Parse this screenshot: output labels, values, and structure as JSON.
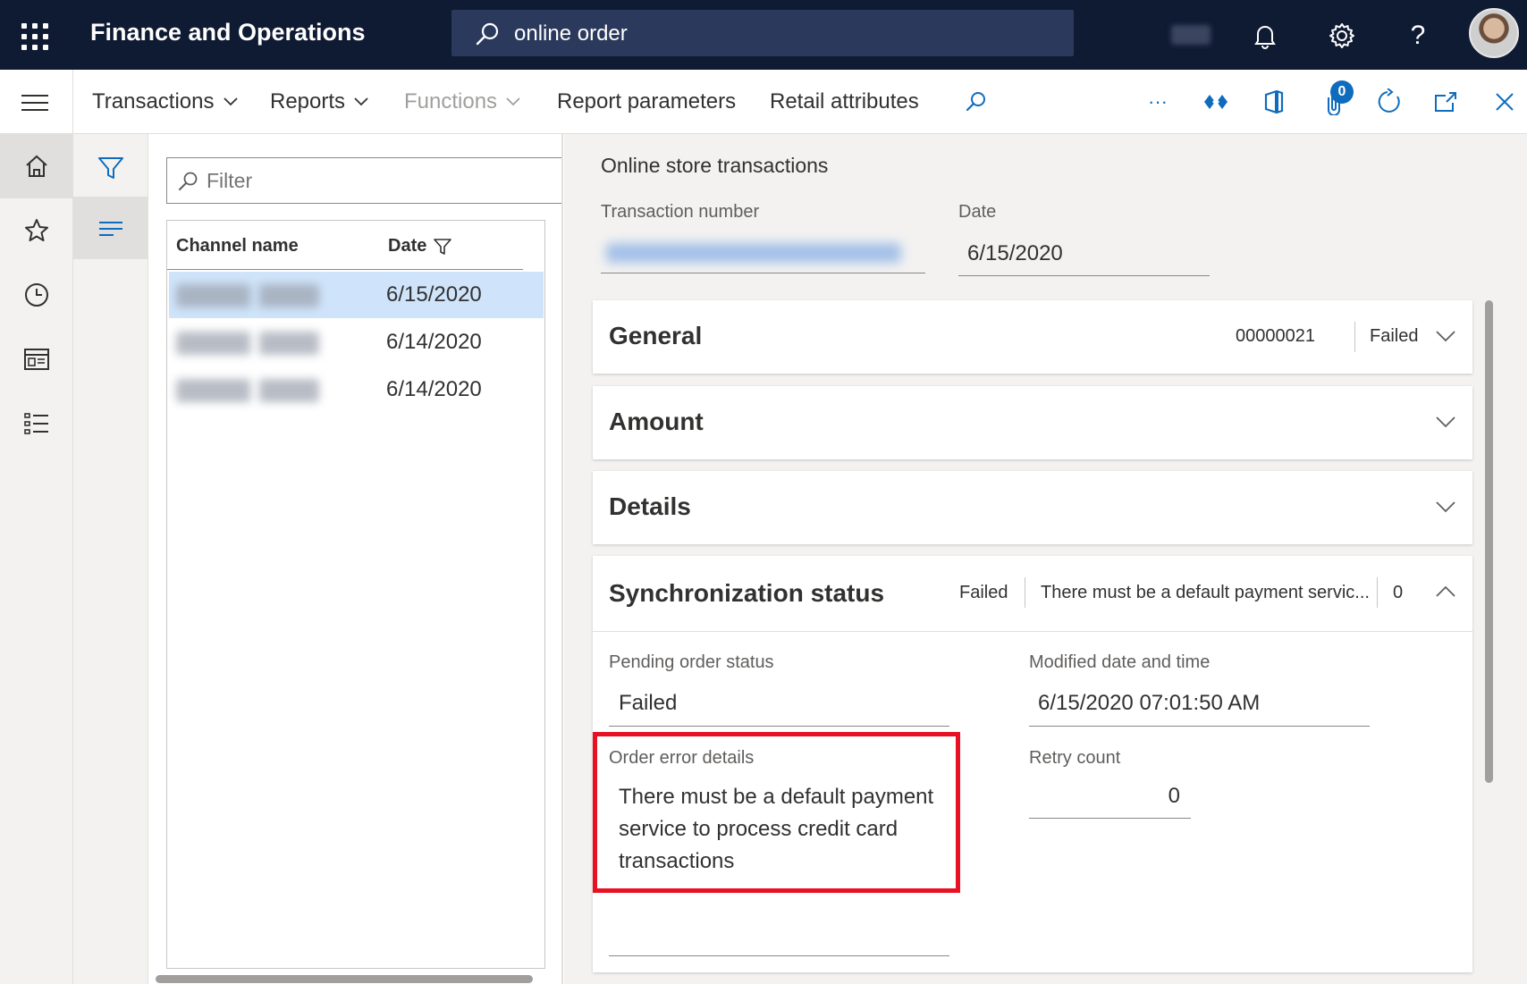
{
  "topbar": {
    "app_title": "Finance and Operations",
    "search_value": "online order",
    "company": "",
    "help_label": "?"
  },
  "commandbar": {
    "menus": [
      {
        "label": "Transactions"
      },
      {
        "label": "Reports"
      },
      {
        "label": "Functions"
      },
      {
        "label": "Report parameters"
      },
      {
        "label": "Retail attributes"
      }
    ],
    "more_label": "···",
    "attachments_count": "0"
  },
  "list": {
    "filter_placeholder": "Filter",
    "columns": [
      "Channel name",
      "Date"
    ],
    "rows": [
      {
        "channel": "",
        "date": "6/15/2020",
        "selected": true
      },
      {
        "channel": "",
        "date": "6/14/2020",
        "selected": false
      },
      {
        "channel": "",
        "date": "6/14/2020",
        "selected": false
      }
    ]
  },
  "details": {
    "page_heading": "Online store transactions",
    "transaction_number_label": "Transaction number",
    "transaction_number_value": "",
    "date_label": "Date",
    "date_value": "6/15/2020",
    "sections": {
      "general": {
        "title": "General",
        "summary_number": "00000021",
        "summary_status": "Failed"
      },
      "amount": {
        "title": "Amount"
      },
      "details": {
        "title": "Details"
      },
      "sync": {
        "title": "Synchronization status",
        "summary_status": "Failed",
        "summary_error": "There must be a default payment servic...",
        "summary_retry": "0",
        "pending_label": "Pending order status",
        "pending_value": "Failed",
        "modified_label": "Modified date and time",
        "modified_value": "6/15/2020 07:01:50 AM",
        "error_label": "Order error details",
        "error_value": "There must be a default payment service to process credit card transactions",
        "retry_label": "Retry count",
        "retry_value": "0"
      }
    }
  },
  "colors": {
    "topbar_bg": "#0f1a33",
    "search_bg": "#2b3a5c",
    "selected_row": "#cfe4fa",
    "accent": "#0f6cbd",
    "highlight_border": "#e81123"
  },
  "icons": [
    "waffle-icon",
    "search-icon",
    "bell-icon",
    "gear-icon",
    "help-icon",
    "hamburger-icon",
    "chevron-down-icon",
    "search-icon",
    "ellipsis-icon",
    "diamond-icon",
    "office-icon",
    "attachment-icon",
    "refresh-icon",
    "open-new-window-icon",
    "close-icon",
    "home-icon",
    "star-icon",
    "clock-icon",
    "workspace-icon",
    "list-icon",
    "filter-icon",
    "list-view-icon",
    "chevron-up-icon"
  ]
}
